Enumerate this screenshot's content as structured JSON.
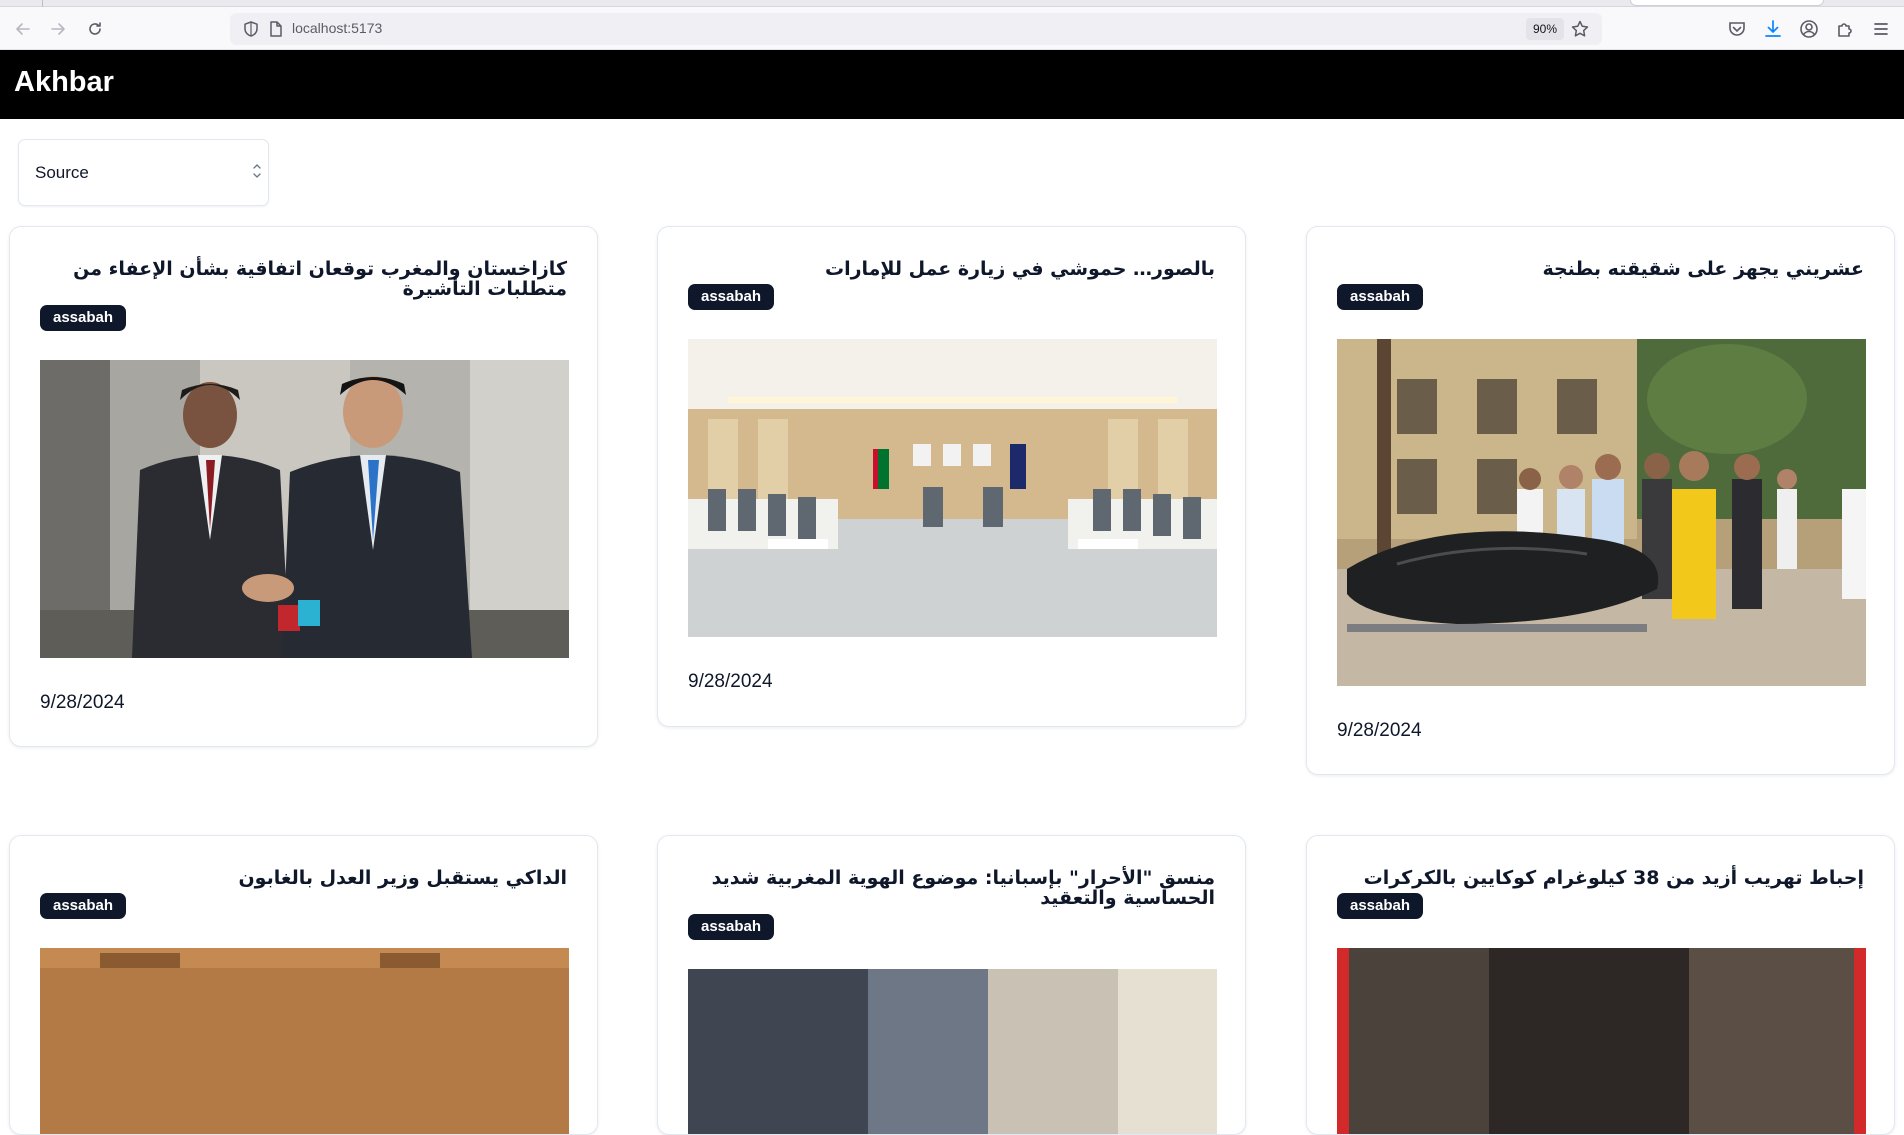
{
  "browser": {
    "url": "localhost:5173",
    "zoom": "90%"
  },
  "app": {
    "title": "Akhbar"
  },
  "filter": {
    "source_label": "Source"
  },
  "articles": [
    {
      "title": "كازاخستان والمغرب توقعان اتفاقية بشأن الإعفاء من متطلبات التأشيرة",
      "source": "assabah",
      "date": "9/28/2024",
      "image": "handshake-photo"
    },
    {
      "title": "بالصور… حموشي في زيارة عمل للإمارات",
      "source": "assabah",
      "date": "9/28/2024",
      "image": "meeting-hall-photo"
    },
    {
      "title": "عشريني يجهز على شقيقته بطنجة",
      "source": "assabah",
      "date": "9/28/2024",
      "image": "crime-scene-photo"
    },
    {
      "title": "الداكي يستقبل وزير العدل بالغابون",
      "source": "assabah",
      "date": "",
      "image": "office-photo"
    },
    {
      "title": "منسق \"الأحرار\" بإسبانيا: موضوع الهوية المغربية شديد الحساسية والتعقيد",
      "source": "assabah",
      "date": "",
      "image": "flags-photo"
    },
    {
      "title": "إحباط تهريب أزيد من 38 كيلوغرام كوكايين بالكركرات",
      "source": "assabah",
      "date": "",
      "image": "seizure-photo"
    }
  ]
}
